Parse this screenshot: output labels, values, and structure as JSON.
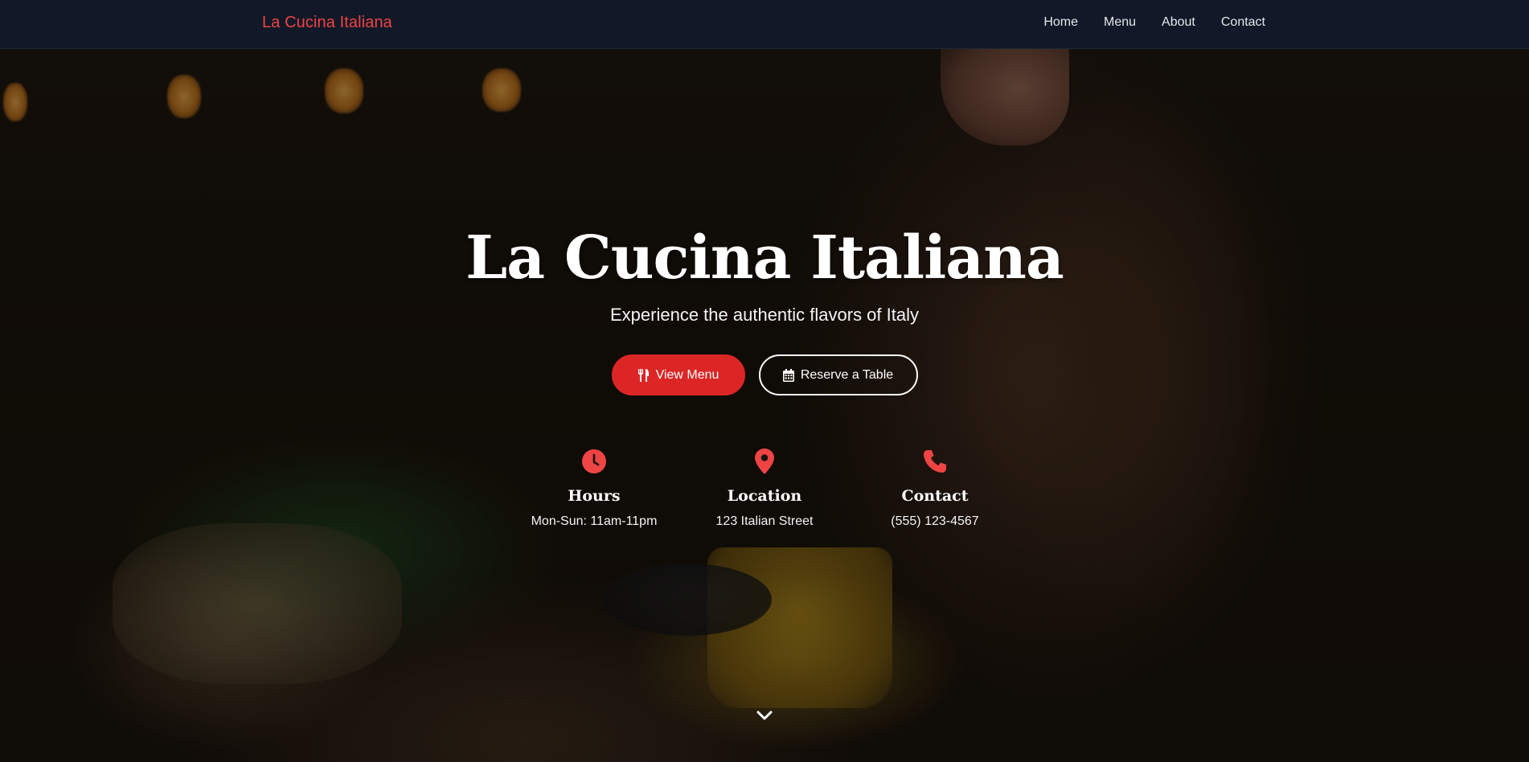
{
  "navbar": {
    "brand": "La Cucina Italiana",
    "links": [
      {
        "label": "Home"
      },
      {
        "label": "Menu"
      },
      {
        "label": "About"
      },
      {
        "label": "Contact"
      }
    ]
  },
  "hero": {
    "title": "La Cucina Italiana",
    "subtitle": "Experience the authentic flavors of Italy",
    "buttons": {
      "view_menu": {
        "label": "View Menu",
        "icon": "utensils-icon"
      },
      "reserve": {
        "label": "Reserve a Table",
        "icon": "calendar-icon"
      }
    },
    "info": [
      {
        "icon": "clock-icon",
        "title": "Hours",
        "text": "Mon-Sun: 11am-11pm"
      },
      {
        "icon": "map-pin-icon",
        "title": "Location",
        "text": "123 Italian Street"
      },
      {
        "icon": "phone-icon",
        "title": "Contact",
        "text": "(555) 123-4567"
      }
    ],
    "scroll_icon": "chevron-down-icon"
  },
  "colors": {
    "accent": "#dc2626",
    "brand": "#ef4444",
    "navbar_bg": "#111827",
    "text": "#ffffff"
  }
}
